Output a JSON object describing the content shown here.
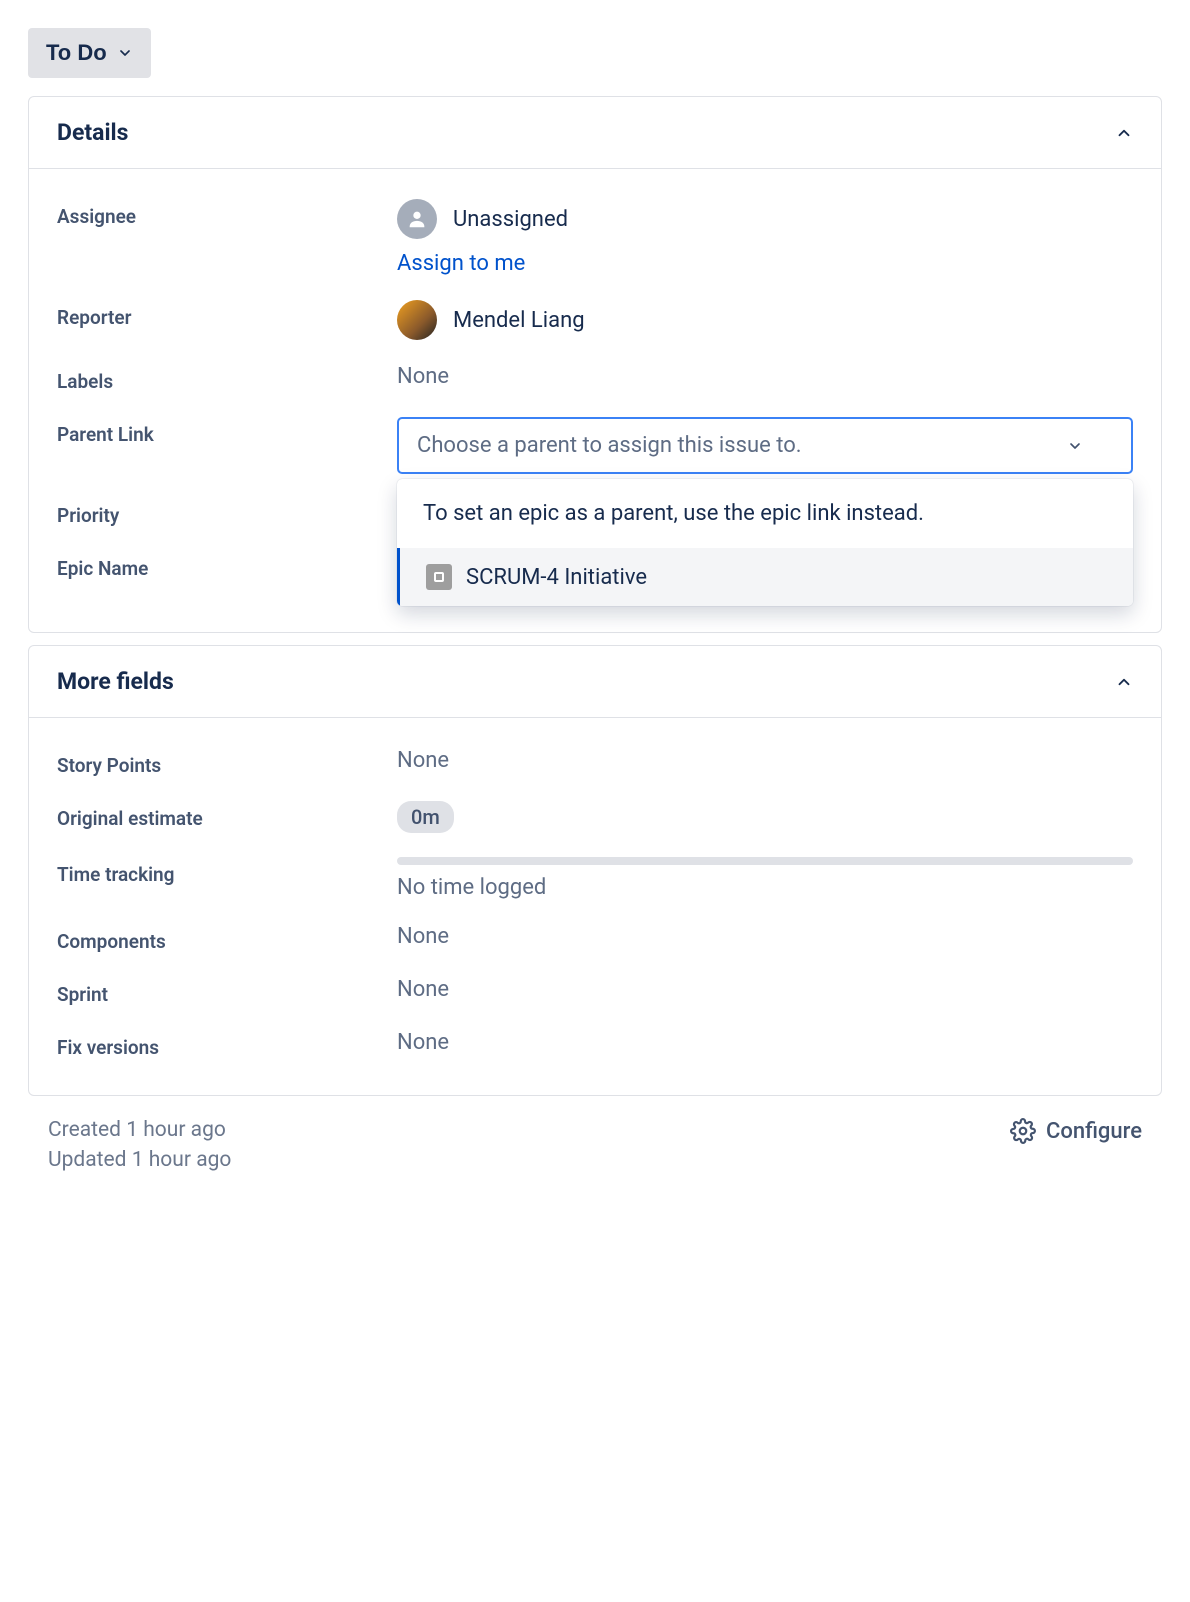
{
  "status": {
    "label": "To Do"
  },
  "details": {
    "title": "Details",
    "assignee": {
      "label": "Assignee",
      "value": "Unassigned",
      "assignToMe": "Assign to me"
    },
    "reporter": {
      "label": "Reporter",
      "value": "Mendel Liang"
    },
    "labels": {
      "label": "Labels",
      "value": "None"
    },
    "parentLink": {
      "label": "Parent Link",
      "placeholder": "Choose a parent to assign this issue to.",
      "dropdown": {
        "message": "To set an epic as a parent, use the epic link instead.",
        "option": "SCRUM-4 Initiative"
      }
    },
    "priority": {
      "label": "Priority"
    },
    "epicName": {
      "label": "Epic Name"
    }
  },
  "moreFields": {
    "title": "More fields",
    "storyPoints": {
      "label": "Story Points",
      "value": "None"
    },
    "originalEstimate": {
      "label": "Original estimate",
      "value": "0m"
    },
    "timeTracking": {
      "label": "Time tracking",
      "value": "No time logged"
    },
    "components": {
      "label": "Components",
      "value": "None"
    },
    "sprint": {
      "label": "Sprint",
      "value": "None"
    },
    "fixVersions": {
      "label": "Fix versions",
      "value": "None"
    }
  },
  "footer": {
    "created": "Created 1 hour ago",
    "updated": "Updated 1 hour ago",
    "configure": "Configure"
  }
}
